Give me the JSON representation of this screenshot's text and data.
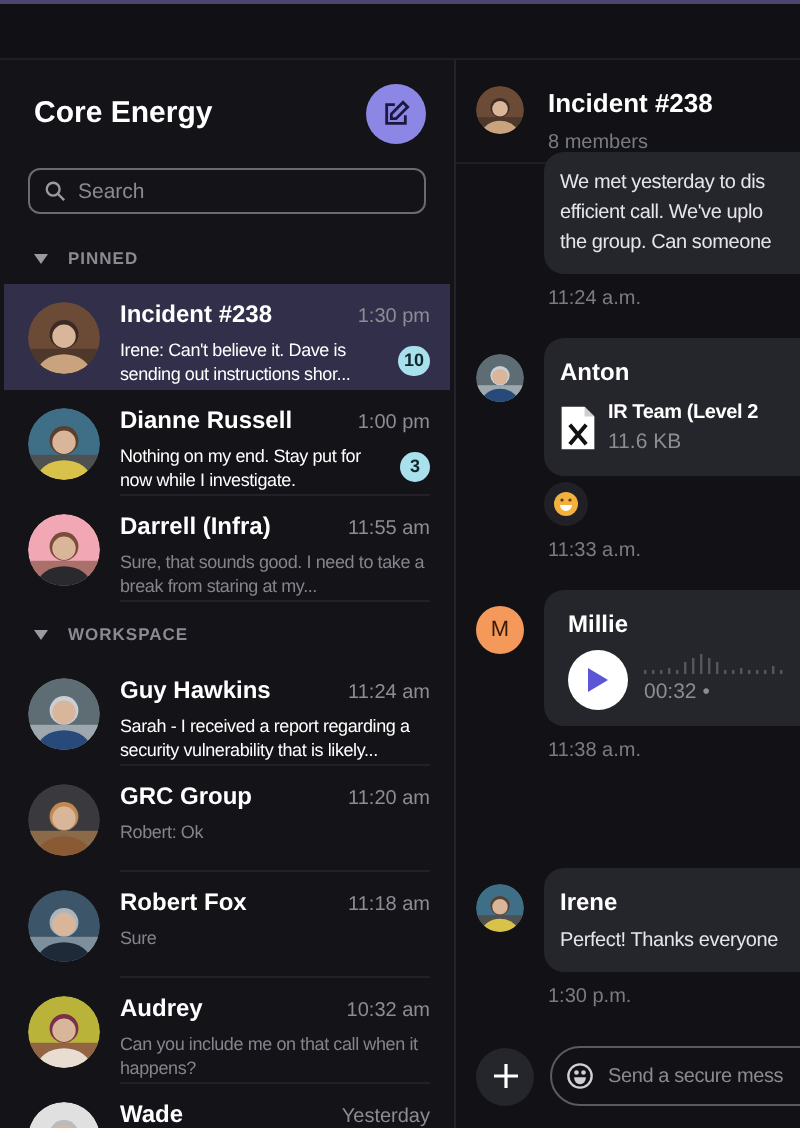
{
  "sidebar": {
    "title": "Core Energy",
    "search": {
      "placeholder": "Search"
    },
    "sections": [
      {
        "label": "PINNED",
        "expanded": true,
        "chats": [
          {
            "name": "Incident #238",
            "time": "1:30 pm",
            "preview": "Irene: Can't believe it. Dave is sending out instructions shor...",
            "unread": true,
            "badge": "10",
            "selected": true
          },
          {
            "name": "Dianne Russell",
            "time": "1:00 pm",
            "preview": "Nothing on my end. Stay put for now while I investigate.",
            "unread": true,
            "badge": "3",
            "selected": false
          },
          {
            "name": "Darrell (Infra)",
            "time": "11:55 am",
            "preview": "Sure, that sounds good. I need to take a break from staring at my...",
            "unread": false,
            "selected": false
          }
        ]
      },
      {
        "label": "WORKSPACE",
        "expanded": true,
        "chats": [
          {
            "name": "Guy Hawkins",
            "time": "11:24 am",
            "preview": "Sarah - I received a report regarding a security vulnerability that is likely...",
            "unread": true,
            "selected": false
          },
          {
            "name": "GRC Group",
            "time": "11:20 am",
            "preview": "Robert: Ok",
            "unread": false,
            "selected": false
          },
          {
            "name": "Robert Fox",
            "time": "11:18 am",
            "preview": "Sure",
            "unread": false,
            "selected": false
          },
          {
            "name": "Audrey",
            "time": "10:32 am",
            "preview": "Can you include me on that call when it happens?",
            "unread": false,
            "selected": false
          },
          {
            "name": "Wade",
            "time": "Yesterday",
            "selected": false
          }
        ]
      }
    ]
  },
  "chat": {
    "title": "Incident #238",
    "subtitle": "8 members",
    "messages": [
      {
        "kind": "text",
        "lines": [
          "We met yesterday to dis",
          "efficient call. We've uplo",
          "the group. Can someone"
        ],
        "time": "11:24 a.m."
      },
      {
        "kind": "file",
        "avatar": {
          "kind": "picture"
        },
        "sender": "Anton",
        "file_name": "IR Team (Level 2",
        "file_size": "11.6 KB",
        "reaction": true,
        "time": "11:33 a.m."
      },
      {
        "kind": "audio",
        "avatar": {
          "kind": "initial",
          "text": "M",
          "color": "#f4995a"
        },
        "sender": "Millie",
        "duration": "00:32 •",
        "time": "11:38 a.m."
      },
      {
        "kind": "text",
        "avatar": {
          "kind": "picture"
        },
        "sender": "Irene",
        "lines": [
          "Perfect! Thanks everyone"
        ],
        "time": "1:30 p.m."
      }
    ],
    "composer": {
      "placeholder": "Send a secure mess"
    }
  }
}
